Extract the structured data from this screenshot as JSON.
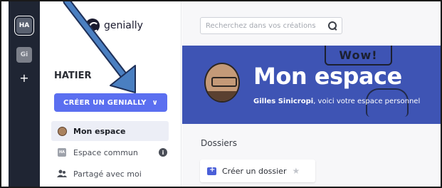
{
  "rail": {
    "active_workspace": "HA",
    "other_workspace": "Gi",
    "add_label": "+"
  },
  "sidebar": {
    "logo_text": "genially",
    "team_name": "HATIER",
    "create_button": "CRÉER UN GENIALLY",
    "items": [
      {
        "label": "Mon espace",
        "icon": "user-avatar-icon",
        "active": true
      },
      {
        "label": "Espace commun",
        "icon": "team-badge-icon",
        "active": false
      },
      {
        "label": "Partagé avec moi",
        "icon": "people-icon",
        "active": false
      }
    ]
  },
  "main": {
    "search": {
      "placeholder": "Recherchez dans vos créations"
    },
    "hero": {
      "title": "Mon espace",
      "wow": "Wow!",
      "subtitle_name": "Gilles Sinicropi",
      "subtitle_rest": ", voici votre espace personnel"
    },
    "section_title": "Dossiers",
    "create_folder": "Créer un dossier"
  },
  "colors": {
    "rail_bg": "#1f2533",
    "accent": "#5b6ff0",
    "hero_bg": "#3e54b4",
    "arrow": "#4a7fc1"
  }
}
